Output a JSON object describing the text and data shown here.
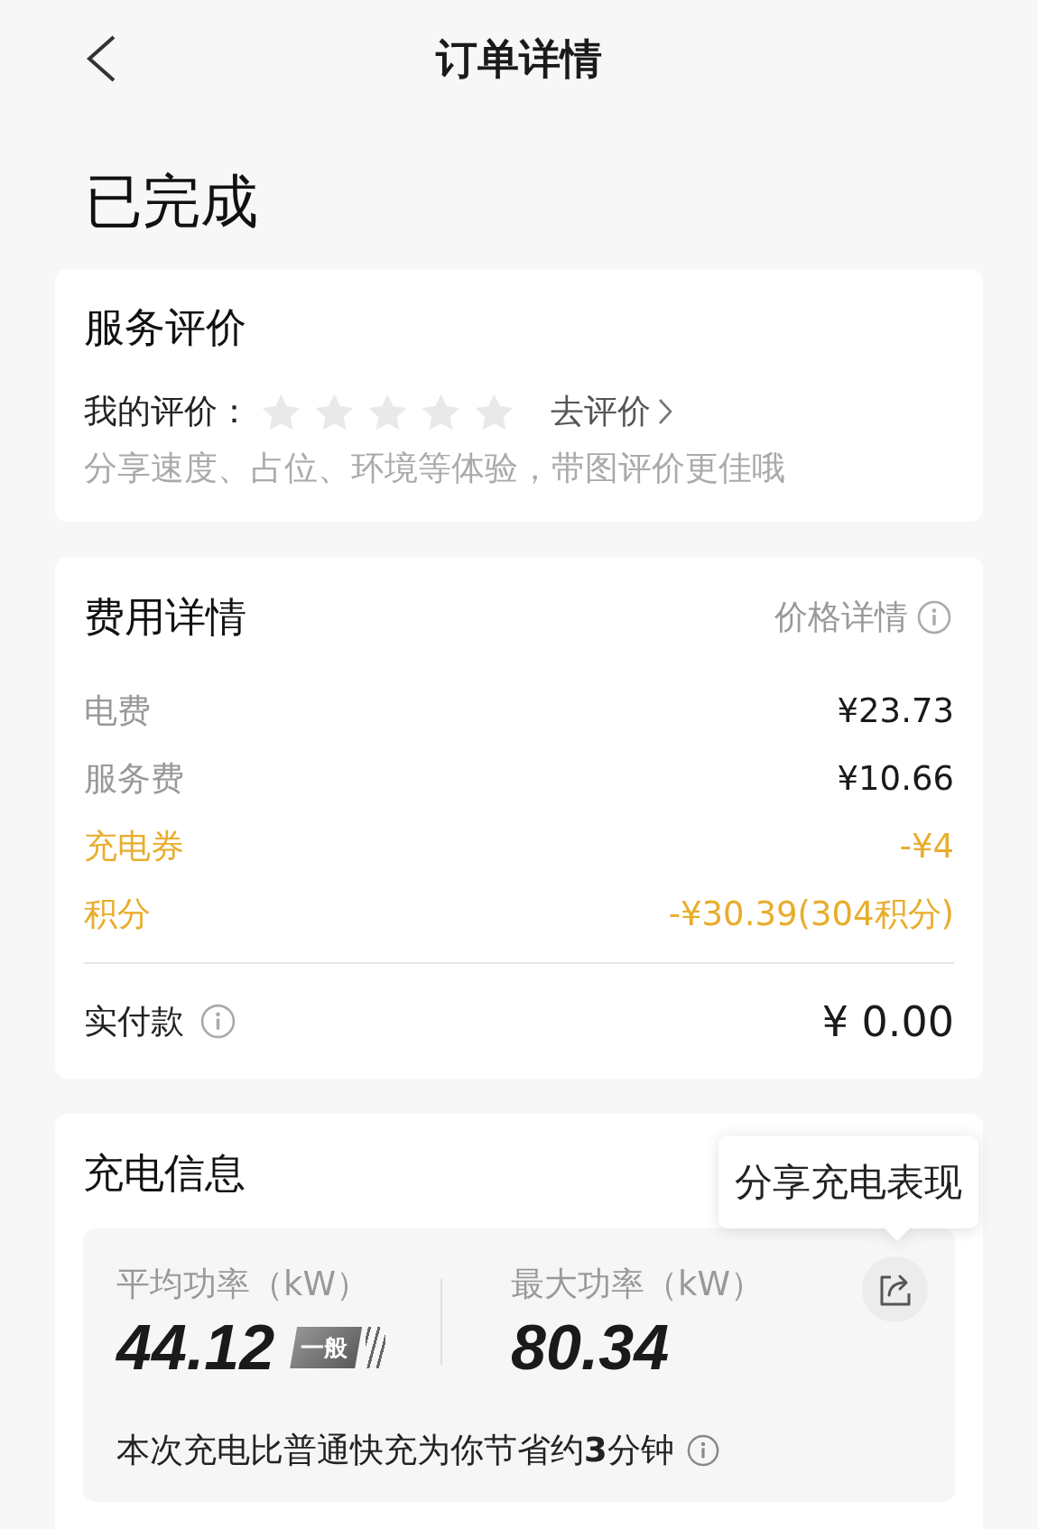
{
  "header": {
    "title": "订单详情"
  },
  "status": "已完成",
  "review": {
    "title": "服务评价",
    "label": "我的评价：",
    "stars": 0,
    "action": "去评价",
    "hint": "分享速度、占位、环境等体验，带图评价更佳哦"
  },
  "fees": {
    "title": "费用详情",
    "link": "价格详情",
    "rows": [
      {
        "kind": "charge",
        "label": "电费",
        "value": "¥23.73"
      },
      {
        "kind": "charge",
        "label": "服务费",
        "value": "¥10.66"
      },
      {
        "kind": "discount",
        "label": "充电券",
        "value": "-¥4"
      },
      {
        "kind": "discount",
        "label": "积分",
        "value": "-¥30.39(304积分)"
      }
    ],
    "total": {
      "label": "实付款",
      "value": "¥ 0.00"
    }
  },
  "charging": {
    "title": "充电信息",
    "tooltip": "分享充电表现",
    "metrics": [
      {
        "label": "平均功率（kW）",
        "value": "44.12",
        "badge": "一般"
      },
      {
        "label": "最大功率（kW）",
        "value": "80.34"
      }
    ],
    "note": "本次充电比普通快充为你节省约**3**分钟"
  }
}
